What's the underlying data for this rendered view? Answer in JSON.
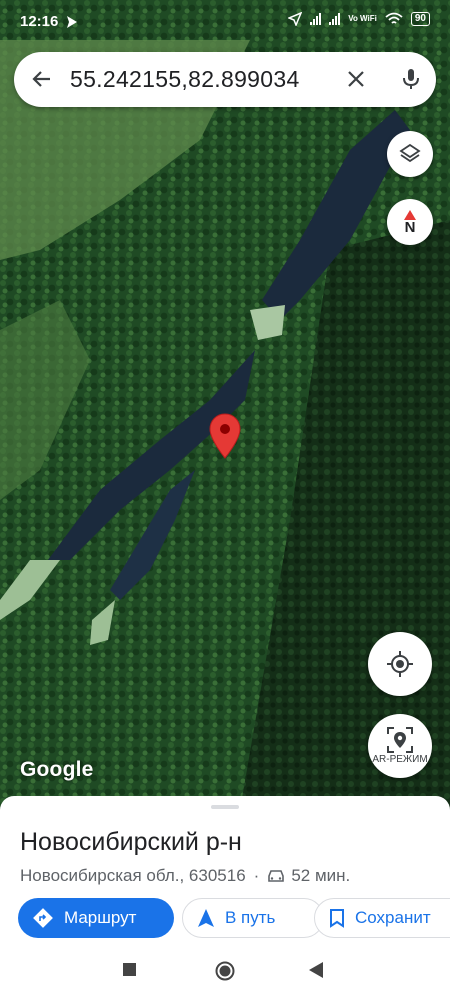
{
  "status_bar": {
    "time": "12:16",
    "battery": "90",
    "network_label": "Vo WiFi"
  },
  "search": {
    "query": "55.242155,82.899034",
    "back_icon": "arrow-back-icon",
    "clear_icon": "close-icon",
    "mic_icon": "mic-icon"
  },
  "map_controls": {
    "layers_icon": "layers-icon",
    "compass_label": "N",
    "my_location_icon": "my-location-icon",
    "ar_label": "AR-РЕЖИМ"
  },
  "map": {
    "watermark": "Google",
    "pin_color": "#e53935"
  },
  "place": {
    "title": "Новосибирский р-н",
    "address": "Новосибирская обл., 630516",
    "separator": "·",
    "travel_time": "52 мин."
  },
  "actions": {
    "route_label": "Маршрут",
    "go_label": "В путь",
    "save_label": "Сохранит"
  },
  "colors": {
    "accent": "#1a73e8",
    "primary_text": "#202124",
    "secondary_text": "#5f6368"
  }
}
